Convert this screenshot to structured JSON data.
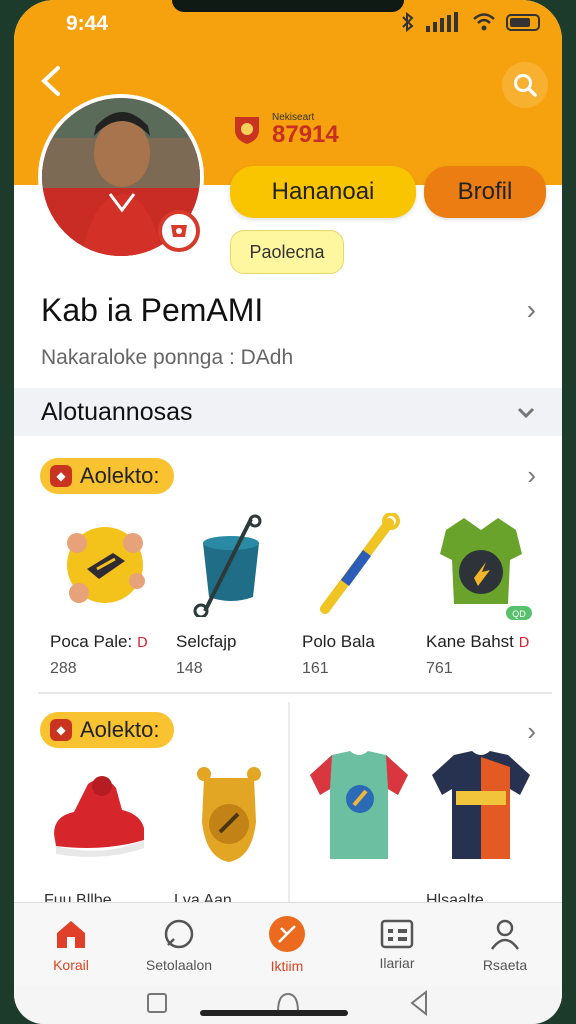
{
  "status": {
    "time": "9:44"
  },
  "header": {
    "club_label": "Nekiseart",
    "club_number": "87914",
    "primary_button": "Hananoai",
    "secondary_button": "Brofil",
    "chip": "Paolecna"
  },
  "profile": {
    "name": "Kab ia PemAMI",
    "subline": "Nakaraloke ponnga : DAdh"
  },
  "section": {
    "title": "Alotuannosas"
  },
  "group1": {
    "label": "Aolekto:",
    "items": [
      {
        "name": "Poca Pale:",
        "mark": "Ⅾ",
        "value": "288"
      },
      {
        "name": "Selcfajp",
        "mark": "",
        "value": "148"
      },
      {
        "name": "Polo Bala",
        "mark": "",
        "value": "161"
      },
      {
        "name": "Kane Bahst",
        "mark": "Ⅾ",
        "value": "761",
        "tag": "QD"
      }
    ]
  },
  "group2": {
    "label": "Aolekto:",
    "items": [
      {
        "name": "Fuu Bllbe"
      },
      {
        "name": "Lva Aan"
      },
      {
        "name": ""
      },
      {
        "name": "Hlsaalte"
      }
    ]
  },
  "tabs": [
    {
      "label": "Korail"
    },
    {
      "label": "Setolaalon"
    },
    {
      "label": "Iktiim"
    },
    {
      "label": "Ilariar"
    },
    {
      "label": "Rsaeta"
    }
  ],
  "colors": {
    "hero": "#f6a20e",
    "yellow_button": "#f9c400",
    "orange_button": "#eb7d12",
    "accent_red": "#d94422"
  }
}
